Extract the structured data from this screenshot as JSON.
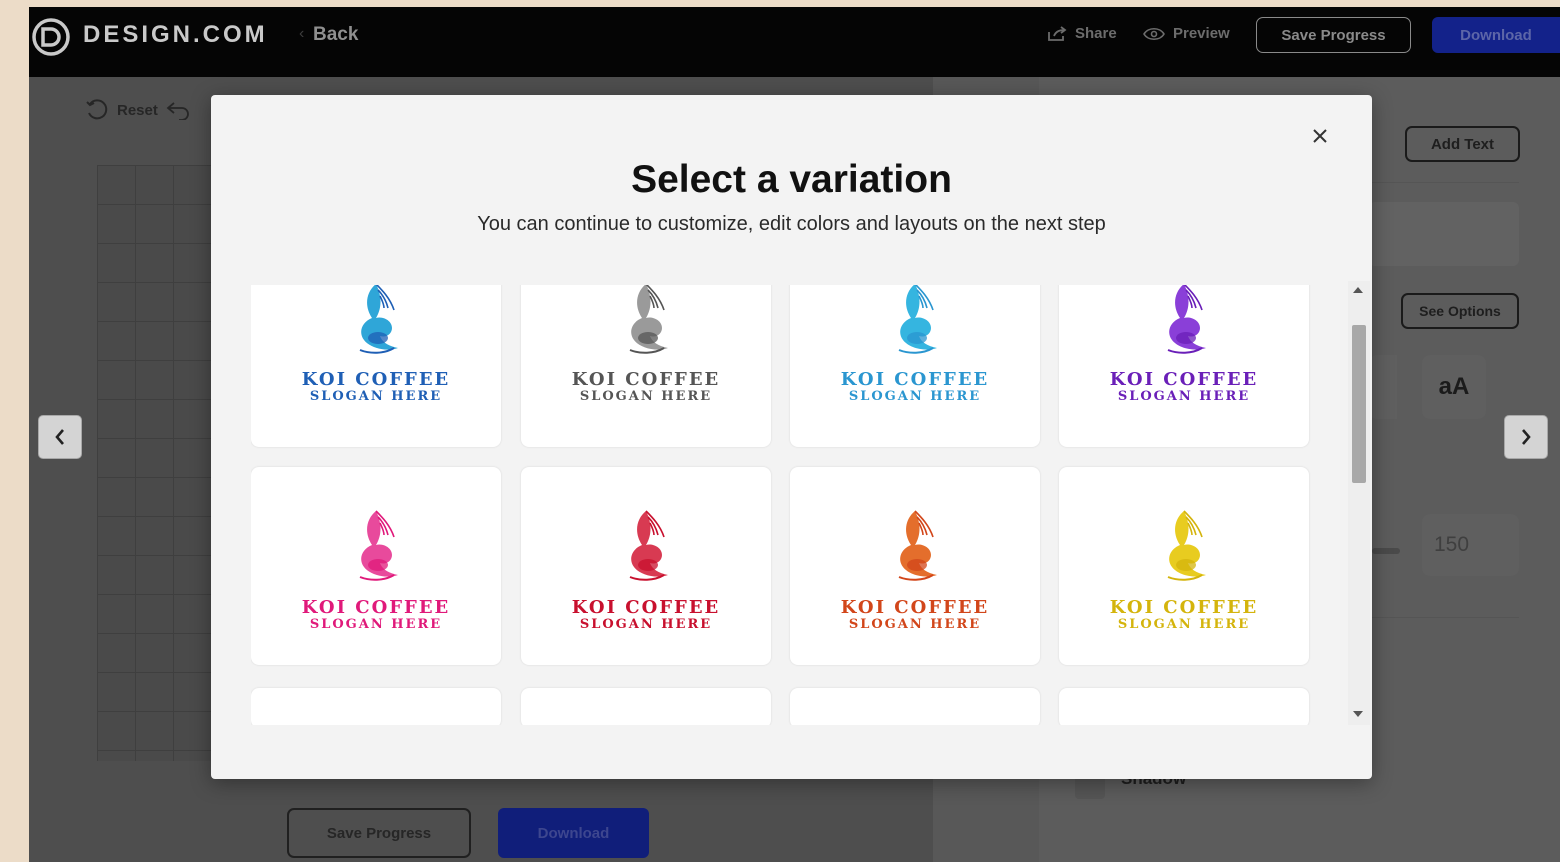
{
  "topbar": {
    "brand": "DESIGN.COM",
    "back_label": "Back",
    "share_label": "Share",
    "preview_label": "Preview",
    "save_label": "Save Progress",
    "download_label": "Download"
  },
  "toolbar": {
    "reset_label": "Reset"
  },
  "right_panel": {
    "add_text_label": "Add Text",
    "see_options_label": "See Options",
    "text_case_label": "aA",
    "size_value": "150",
    "shadow_label": "Shadow"
  },
  "bottom_bar": {
    "save_label": "Save Progress",
    "download_label": "Download"
  },
  "modal": {
    "title": "Select a variation",
    "subtitle": "You can continue to customize, edit colors and layouts on the next step",
    "variations": [
      {
        "name": "KOI COFFEE",
        "slogan": "SLOGAN HERE",
        "color": "#1f5fb5",
        "accent": "#2fa6d8"
      },
      {
        "name": "KOI COFFEE",
        "slogan": "SLOGAN HERE",
        "color": "#555555",
        "accent": "#9a9a9a"
      },
      {
        "name": "KOI COFFEE",
        "slogan": "SLOGAN HERE",
        "color": "#2a96d0",
        "accent": "#35b5e0"
      },
      {
        "name": "KOI COFFEE",
        "slogan": "SLOGAN HERE",
        "color": "#6a1fb8",
        "accent": "#8a3fd8"
      },
      {
        "name": "KOI COFFEE",
        "slogan": "SLOGAN HERE",
        "color": "#e0197a",
        "accent": "#e84a9c"
      },
      {
        "name": "KOI COFFEE",
        "slogan": "SLOGAN HERE",
        "color": "#c8102e",
        "accent": "#d83a52"
      },
      {
        "name": "KOI COFFEE",
        "slogan": "SLOGAN HERE",
        "color": "#d2461a",
        "accent": "#e46e2c"
      },
      {
        "name": "KOI COFFEE",
        "slogan": "SLOGAN HERE",
        "color": "#d4b40c",
        "accent": "#e8cc20"
      }
    ]
  }
}
